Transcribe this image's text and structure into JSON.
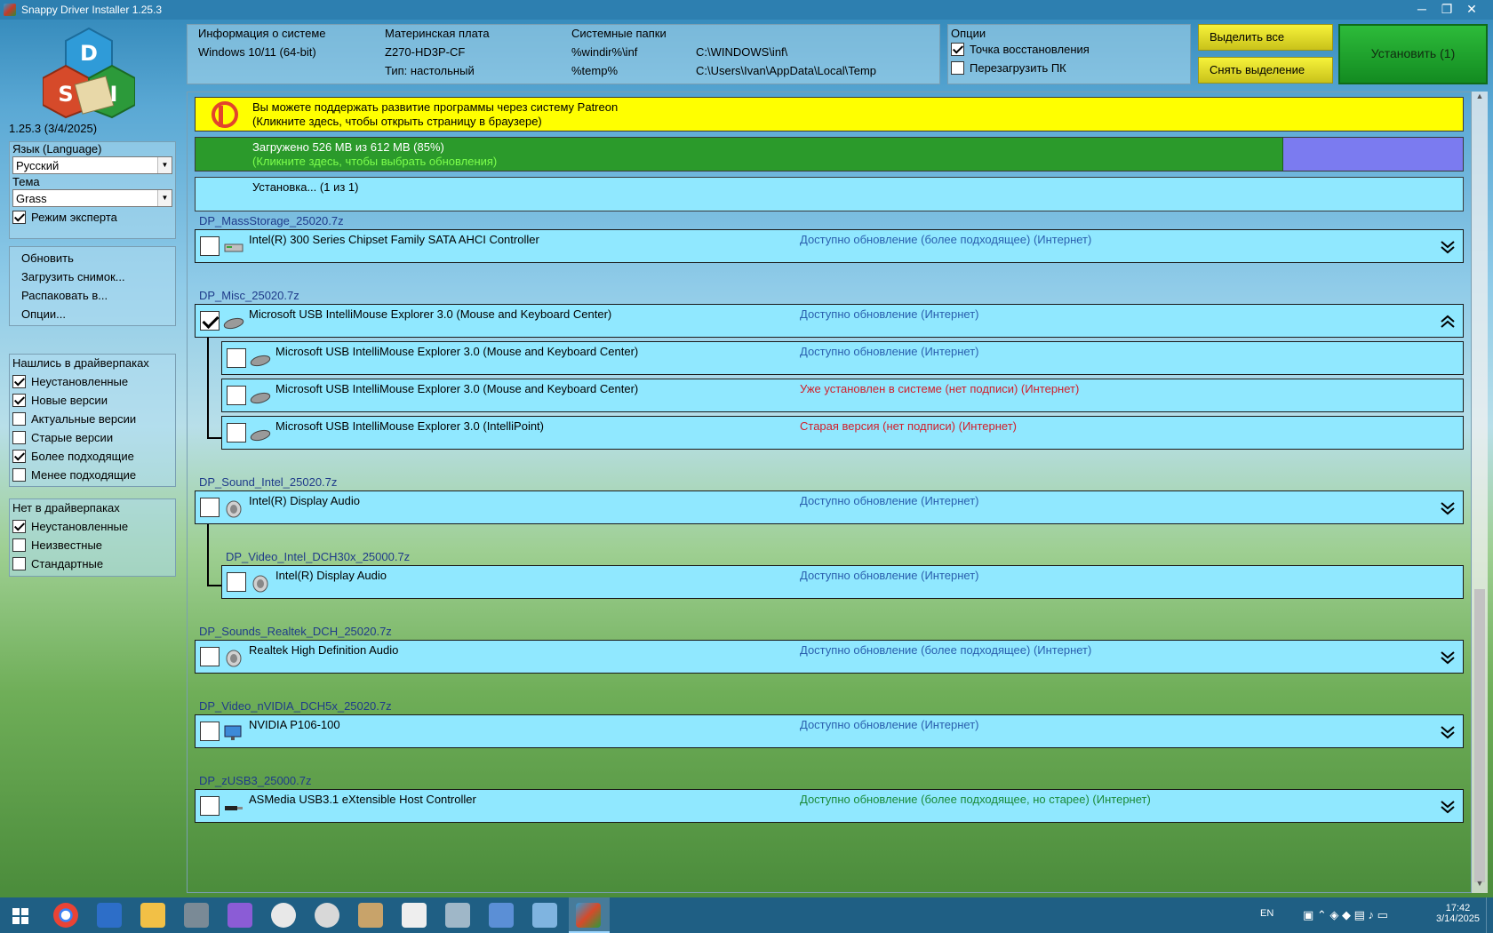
{
  "window": {
    "title": "Snappy Driver Installer 1.25.3",
    "minimize": "─",
    "maximize": "❐",
    "close": "✕"
  },
  "app": {
    "version": "1.25.3 (3/4/2025)",
    "logo_letters": [
      "D",
      "S",
      "I"
    ]
  },
  "left": {
    "language_label": "Язык (Language)",
    "language_value": "Русский",
    "theme_label": "Тема",
    "theme_value": "Grass",
    "expert_mode": {
      "label": "Режим эксперта",
      "checked": true
    },
    "menu": [
      "Обновить",
      "Загрузить снимок...",
      "Распаковать в...",
      "Опции..."
    ],
    "found_title": "Нашлись в драйверпаках",
    "found": [
      {
        "label": "Неустановленные",
        "checked": true
      },
      {
        "label": "Новые версии",
        "checked": true
      },
      {
        "label": "Актуальные версии",
        "checked": false
      },
      {
        "label": "Старые версии",
        "checked": false
      },
      {
        "label": "Более подходящие",
        "checked": true
      },
      {
        "label": "Менее подходящие",
        "checked": false
      }
    ],
    "notfound_title": "Нет в драйверпаках",
    "notfound": [
      {
        "label": "Неустановленные",
        "checked": true
      },
      {
        "label": "Неизвестные",
        "checked": false
      },
      {
        "label": "Стандартные",
        "checked": false
      }
    ]
  },
  "sysinfo": {
    "h1": "Информация о системе",
    "os": "Windows 10/11 (64-bit)",
    "h2": "Материнская плата",
    "mb": "Z270-HD3P-CF",
    "type": "Тип: настольный",
    "h3": "Системные папки",
    "k1": "%windir%\\inf",
    "v1": "C:\\WINDOWS\\inf\\",
    "k2": "%temp%",
    "v2": "C:\\Users\\Ivan\\AppData\\Local\\Temp"
  },
  "options": {
    "title": "Опции",
    "restore": {
      "label": "Точка восстановления",
      "checked": true
    },
    "reboot": {
      "label": "Перезагрузить ПК",
      "checked": false
    }
  },
  "buttons": {
    "select_all": "Выделить все",
    "deselect": "Снять выделение",
    "install": "Установить (1)"
  },
  "banners": {
    "patreon1": "Вы можете поддержать развитие программы через систему Patreon",
    "patreon2": "(Кликните здесь, чтобы открыть страницу в браузере)",
    "progress1": "Загружено 526 MB из 612 MB (85%)",
    "progress2": "(Кликните здесь, чтобы выбрать обновления)",
    "progress_fraction": 0.858,
    "install": "Установка...  (1 из 1)"
  },
  "colors": {
    "status_blue": "#2a5fae",
    "status_red": "#d0202c",
    "status_green": "#1b8a3a",
    "progress_green": "#2b9a2b",
    "row_bg": "#90e8ff"
  },
  "groups": [
    {
      "name": "DP_MassStorage_25020.7z"
    },
    {
      "name": "DP_Misc_25020.7z"
    },
    {
      "name": "DP_Sound_Intel_25020.7z"
    },
    {
      "name": "DP_Video_Intel_DCH30x_25000.7z"
    },
    {
      "name": "DP_Sounds_Realtek_DCH_25020.7z"
    },
    {
      "name": "DP_Video_nVIDIA_DCH5x_25020.7z"
    },
    {
      "name": "DP_zUSB3_25000.7z"
    }
  ],
  "drivers": [
    {
      "name": "Intel(R) 300 Series Chipset Family SATA AHCI Controller",
      "status": "Доступно обновление (более подходящее) (Интернет)",
      "status_color": "blue",
      "checked": false,
      "icon": "storage-icon",
      "chevron": "down"
    },
    {
      "name": "Microsoft USB IntelliMouse Explorer 3.0 (Mouse and Keyboard Center)",
      "status": "Доступно обновление (Интернет)",
      "status_color": "blue",
      "checked": true,
      "icon": "mouse-icon",
      "chevron": "up"
    },
    {
      "name": "Microsoft USB IntelliMouse Explorer 3.0 (Mouse and Keyboard Center)",
      "status": "Доступно обновление (Интернет)",
      "status_color": "blue",
      "checked": false,
      "icon": "mouse-icon"
    },
    {
      "name": "Microsoft USB IntelliMouse Explorer 3.0 (Mouse and Keyboard Center)",
      "status": "Уже установлен в системе (нет подписи) (Интернет)",
      "status_color": "red",
      "checked": false,
      "icon": "mouse-icon"
    },
    {
      "name": "Microsoft USB IntelliMouse Explorer 3.0 (IntelliPoint)",
      "status": "Старая версия (нет подписи) (Интернет)",
      "status_color": "red",
      "checked": false,
      "icon": "mouse-icon"
    },
    {
      "name": "Intel(R) Display Audio",
      "status": "Доступно обновление (Интернет)",
      "status_color": "blue",
      "checked": false,
      "icon": "speaker-icon",
      "chevron": "down"
    },
    {
      "name": "Intel(R) Display Audio",
      "status": "Доступно обновление (Интернет)",
      "status_color": "blue",
      "checked": false,
      "icon": "speaker-icon"
    },
    {
      "name": "Realtek High Definition Audio",
      "status": "Доступно обновление (более подходящее) (Интернет)",
      "status_color": "blue",
      "checked": false,
      "icon": "speaker-icon",
      "chevron": "down"
    },
    {
      "name": "NVIDIA P106-100",
      "status": "Доступно обновление (Интернет)",
      "status_color": "blue",
      "checked": false,
      "icon": "monitor-icon",
      "chevron": "down"
    },
    {
      "name": "ASMedia USB3.1 eXtensible Host Controller",
      "status": "Доступно обновление (более подходящее, но старее) (Интернет)",
      "status_color": "green",
      "checked": false,
      "icon": "usb-icon",
      "chevron": "down"
    }
  ],
  "taskbar": {
    "lang": "EN",
    "time": "17:42",
    "date": "3/14/2025"
  }
}
